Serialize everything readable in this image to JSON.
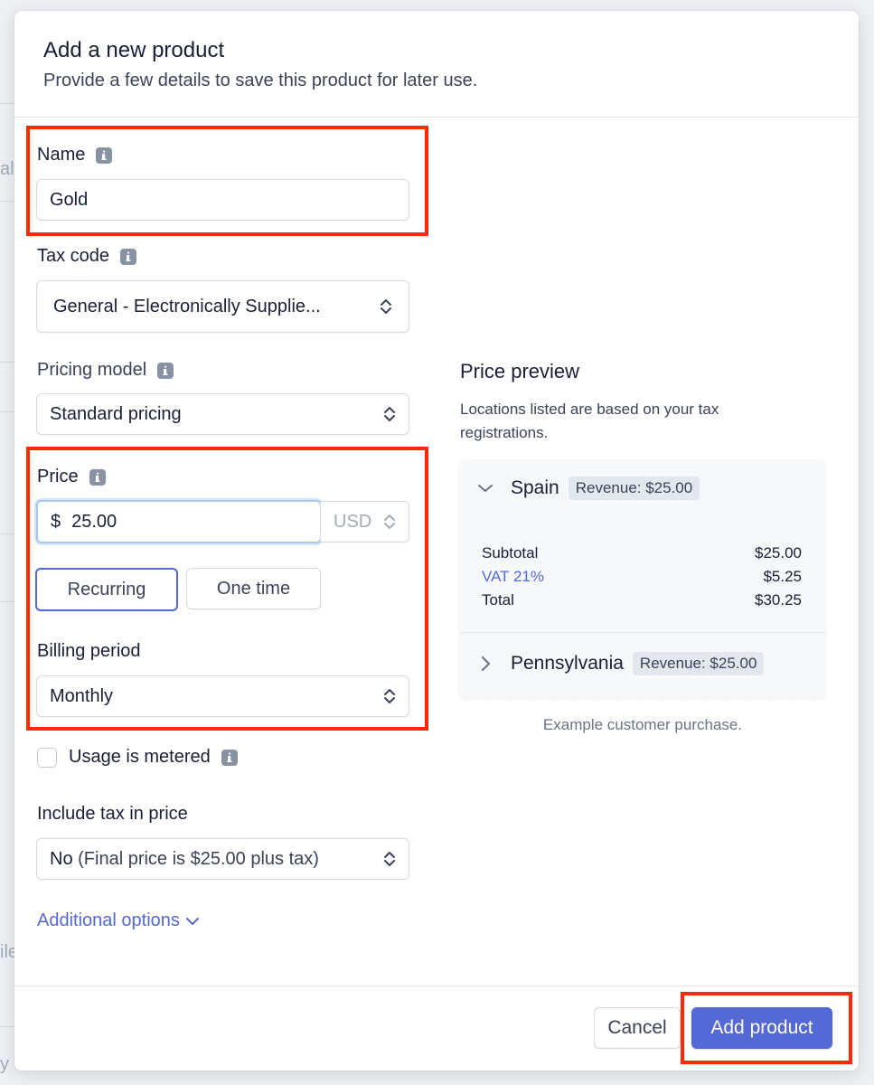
{
  "background": {
    "fragments": [
      "al",
      "ile",
      "y"
    ]
  },
  "modal": {
    "title": "Add a new product",
    "subtitle": "Provide a few details to save this product for later use."
  },
  "form": {
    "name": {
      "label": "Name",
      "value": "Gold"
    },
    "tax_code": {
      "label": "Tax code",
      "value": "General - Electronically Supplie..."
    },
    "pricing_model": {
      "label": "Pricing model",
      "value": "Standard pricing"
    },
    "price": {
      "label": "Price",
      "currency_symbol": "$",
      "amount": "25.00",
      "currency": "USD"
    },
    "price_type": {
      "options": [
        "Recurring",
        "One time"
      ],
      "selected": "Recurring"
    },
    "billing_period": {
      "label": "Billing period",
      "value": "Monthly"
    },
    "usage_metered": {
      "label": "Usage is metered",
      "checked": false
    },
    "include_tax": {
      "label": "Include tax in price",
      "value_bold": "No",
      "value_rest": " (Final price is $25.00 plus tax)"
    },
    "additional_options": "Additional options"
  },
  "preview": {
    "title": "Price preview",
    "description": "Locations listed are based on your tax registrations.",
    "locations": [
      {
        "name": "Spain",
        "badge": "Revenue: $25.00",
        "expanded": true,
        "lines": [
          {
            "label": "Subtotal",
            "value": "$25.00"
          },
          {
            "label": "VAT 21%",
            "value": "$5.25"
          },
          {
            "label": "Total",
            "value": "$30.25"
          }
        ]
      },
      {
        "name": "Pennsylvania",
        "badge": "Revenue: $25.00",
        "expanded": false
      }
    ],
    "caption": "Example customer purchase."
  },
  "footer": {
    "cancel_label": "Cancel",
    "submit_label": "Add product"
  },
  "colors": {
    "accent": "#5469d4",
    "annotation": "#ff2a00",
    "focus": "#a4c8ee"
  }
}
